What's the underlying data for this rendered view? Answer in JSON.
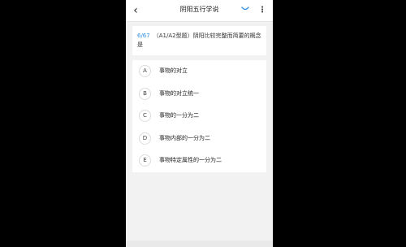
{
  "header": {
    "title": "阴阳五行学说",
    "back_icon": "back-chevron-icon",
    "feedback_icon": "smile-icon",
    "more_icon": "more-vertical-icon",
    "accent_color": "#2f8fe8"
  },
  "question": {
    "number": "6/67",
    "text": "（A1/A2型题）阴阳比较完整而简要的概念是"
  },
  "options": [
    {
      "letter": "A",
      "text": "事物的对立"
    },
    {
      "letter": "B",
      "text": "事物的对立统一"
    },
    {
      "letter": "C",
      "text": "事物的一分为二"
    },
    {
      "letter": "D",
      "text": "事物内部的一分为二"
    },
    {
      "letter": "E",
      "text": "事物特定属性的一分为二"
    }
  ]
}
